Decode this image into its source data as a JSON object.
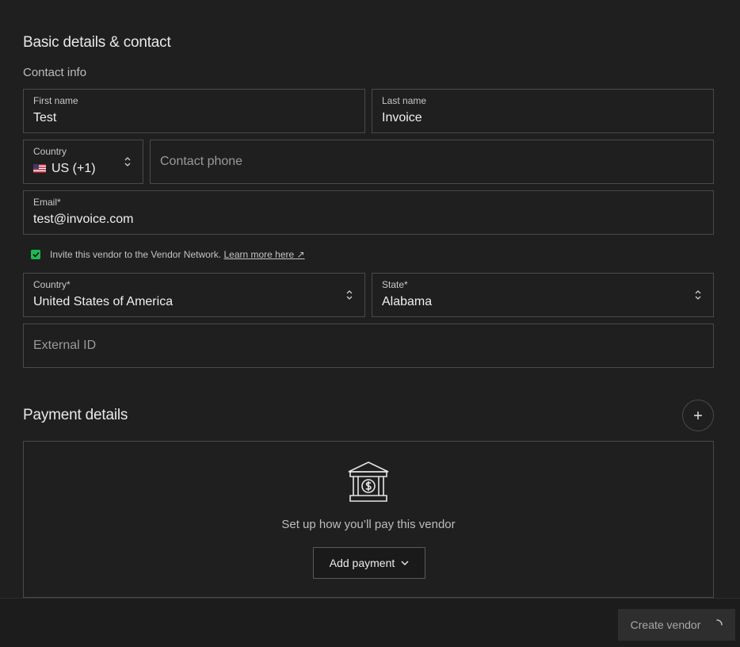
{
  "basic": {
    "title": "Basic details & contact",
    "contact_info": "Contact info",
    "first_name": {
      "label": "First name",
      "value": "Test"
    },
    "last_name": {
      "label": "Last name",
      "value": "Invoice"
    },
    "phone_country": {
      "label": "Country",
      "value": "US (+1)",
      "flag": "🇺🇸"
    },
    "phone": {
      "placeholder": "Contact phone"
    },
    "email": {
      "label": "Email*",
      "value": "test@invoice.com"
    },
    "invite": {
      "text": "Invite this vendor to the Vendor Network.",
      "link": "Learn more here ↗",
      "checked": true
    },
    "country": {
      "label": "Country*",
      "value": "United States of America"
    },
    "state": {
      "label": "State*",
      "value": "Alabama"
    },
    "external_id": {
      "placeholder": "External ID"
    }
  },
  "payment": {
    "title": "Payment details",
    "empty_text": "Set up how you’ll pay this vendor",
    "add_label": "Add payment",
    "plus_icon": "plus-icon",
    "bank_icon": "bank-icon"
  },
  "footer": {
    "create_label": "Create vendor"
  },
  "colors": {
    "background": "#1f1f1f",
    "border": "#4a4a4a",
    "check": "#1db954"
  }
}
